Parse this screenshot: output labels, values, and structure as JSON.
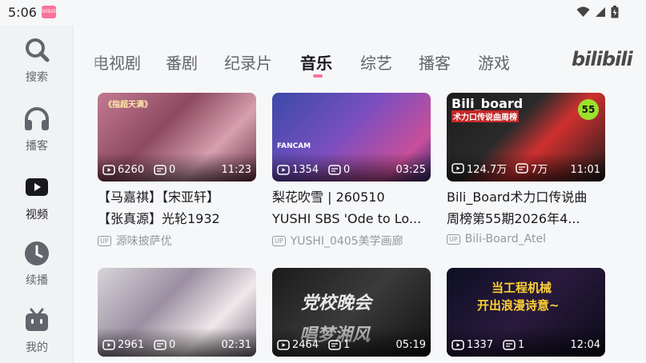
{
  "status_bar": {
    "time": "5:06",
    "app_badge": "bilibili"
  },
  "sidebar": {
    "items": [
      {
        "label": "搜索",
        "icon": "search-icon"
      },
      {
        "label": "播客",
        "icon": "headphones-icon"
      },
      {
        "label": "视频",
        "icon": "play-video-icon",
        "active": true
      },
      {
        "label": "续播",
        "icon": "clock-icon"
      },
      {
        "label": "我的",
        "icon": "tv-face-icon"
      }
    ]
  },
  "tabs": [
    {
      "label": "电视剧"
    },
    {
      "label": "番剧"
    },
    {
      "label": "纪录片"
    },
    {
      "label": "音乐",
      "active": true
    },
    {
      "label": "综艺"
    },
    {
      "label": "播客"
    },
    {
      "label": "游戏"
    }
  ],
  "logo": "bilibili",
  "accent_color": "#fb7299",
  "cards": [
    {
      "plays": "6260",
      "danmaku": "0",
      "duration": "11:23",
      "title_line1": "【马嘉祺】【宋亚轩】",
      "title_line2": "【张真源】光轮1932",
      "uploader": "源味披萨优",
      "thumb_text": "《指超天满》"
    },
    {
      "plays": "1354",
      "danmaku": "0",
      "duration": "03:25",
      "title_line1": "梨花吹雪 | 260510",
      "title_line2": "YUSHI SBS 'Ode to Lo...",
      "uploader": "YUSHI_0405美学画廊",
      "thumb_text": "FANCAM"
    },
    {
      "plays": "124.7万",
      "danmaku": "7万",
      "duration": "11:01",
      "title_line1": "Bili_Board术力口传说曲",
      "title_line2": "周榜第55期2026年4...",
      "uploader": "Bili-Board_Atel",
      "thumb_text": "Bili_board",
      "thumb_sub": "术力口传说曲周榜",
      "thumb_num": "55"
    },
    {
      "plays": "2961",
      "danmaku": "0",
      "duration": "02:31",
      "title_line1": "",
      "title_line2": "",
      "uploader": ""
    },
    {
      "plays": "2464",
      "danmaku": "1",
      "duration": "05:19",
      "title_line1": "",
      "title_line2": "",
      "uploader": "",
      "thumb_text": "党校晚会",
      "thumb_sub": "唱梦湘风"
    },
    {
      "plays": "1337",
      "danmaku": "1",
      "duration": "12:04",
      "title_line1": "",
      "title_line2": "",
      "uploader": "",
      "thumb_text": "当工程机械",
      "thumb_sub": "开出浪漫诗意~"
    }
  ],
  "up_badge": "UP"
}
